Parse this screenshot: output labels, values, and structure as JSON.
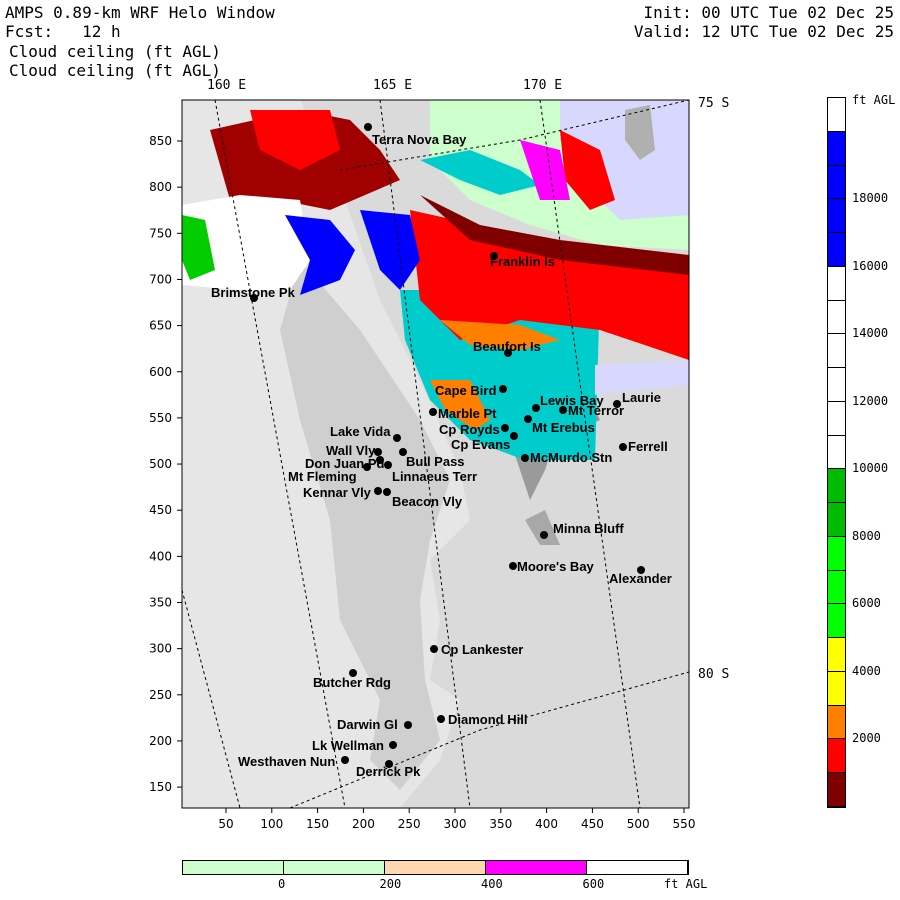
{
  "header": {
    "title": "AMPS 0.89-km WRF Helo Window",
    "forecast": "Fcst:   12 h",
    "init": "Init: 00 UTC Tue 02 Dec 25",
    "valid": "Valid: 12 UTC Tue 02 Dec 25",
    "field1": "Cloud ceiling (ft AGL)",
    "field2": "Cloud ceiling (ft AGL)"
  },
  "map": {
    "longitude_labels": [
      "160 E",
      "165 E",
      "170 E"
    ],
    "latitude_labels": [
      "75 S",
      "80 S"
    ],
    "x_ticks": [
      "50",
      "100",
      "150",
      "200",
      "250",
      "300",
      "350",
      "400",
      "450",
      "500",
      "550"
    ],
    "y_ticks": [
      "850",
      "800",
      "750",
      "700",
      "650",
      "600",
      "550",
      "500",
      "450",
      "400",
      "350",
      "300",
      "250",
      "200",
      "150"
    ],
    "stations": [
      "Terra Nova Bay",
      "Franklin Is",
      "Brimstone Pk",
      "Beaufort Is",
      "Cape Bird",
      "Marble Pt",
      "Lewis Bay",
      "Mt Terror",
      "Laurie",
      "Mt Erebus",
      "Cp Royds",
      "Lake Vida",
      "Cp Evans",
      "Ferrell",
      "Wall Vly",
      "Bull Pass",
      "McMurdo Stn",
      "Don Juan Pd",
      "Mt Fleming",
      "Linnaeus Terr",
      "Kennar Vly",
      "Beacon Vly",
      "Minna Bluff",
      "Moore's Bay",
      "Alexander",
      "Cp Lankester",
      "Butcher Rdg",
      "Darwin Gl",
      "Diamond Hill",
      "Lk Wellman",
      "Westhaven Nun",
      "Derrick Pk"
    ]
  },
  "ceiling_colorbar": {
    "unit": "ft AGL",
    "labels": [
      "18000",
      "16000",
      "14000",
      "12000",
      "10000",
      "8000",
      "6000",
      "4000",
      "2000"
    ],
    "colors": [
      "#ffffff",
      "#0000ff",
      "#0000ff",
      "#0000ff",
      "#0000ff",
      "#ffffff",
      "#ffffff",
      "#ffffff",
      "#ffffff",
      "#ffffff",
      "#ffffff",
      "#00bb00",
      "#00bb00",
      "#00ff00",
      "#00ff00",
      "#00ff00",
      "#ffff00",
      "#ffff00",
      "#ff8000",
      "#ff0000",
      "#800000"
    ]
  },
  "low_colorbar": {
    "unit": "ft AGL",
    "labels": [
      "0",
      "200",
      "400",
      "600"
    ],
    "colors": [
      "#ccffcc",
      "#ccffcc",
      "#ffd8b0",
      "#ff00ff",
      "#ffffff"
    ]
  }
}
